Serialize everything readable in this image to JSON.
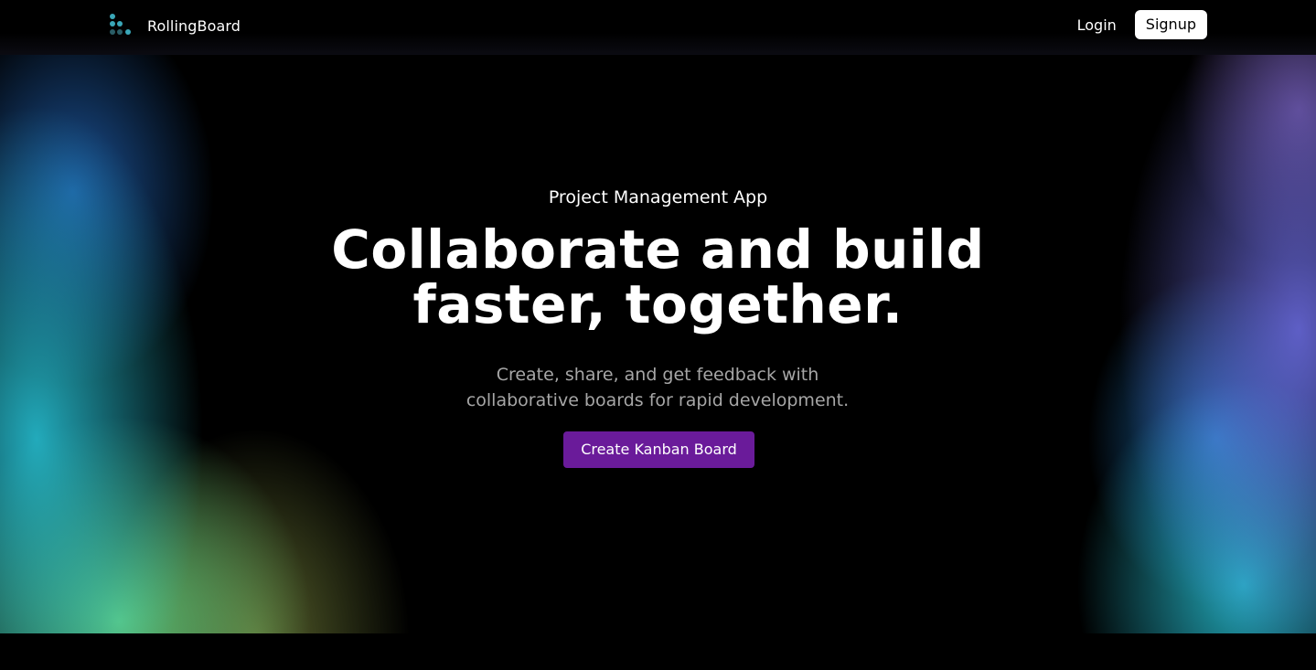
{
  "nav": {
    "brand_name": "RollingBoard",
    "login_label": "Login",
    "signup_label": "Signup",
    "logo_icon": "dots-grid-logo-icon"
  },
  "hero": {
    "eyebrow": "Project Management App",
    "headline_line1": "Collaborate and build",
    "headline_line2": "faster, together.",
    "subtitle_line1": "Create, share, and get feedback with",
    "subtitle_line2": "collaborative boards for rapid development.",
    "cta_label": "Create Kanban Board"
  },
  "colors": {
    "cta": "#6a1b9a",
    "logo_teal": "#3aa7b8",
    "logo_dark": "#2a5d66",
    "subtitle": "#a6a6a6"
  }
}
